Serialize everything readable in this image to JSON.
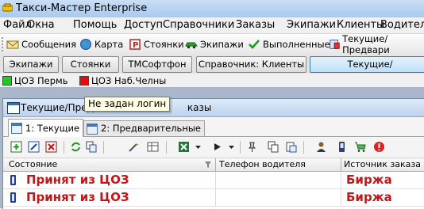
{
  "window": {
    "title": "Такси-Мастер Enterprise"
  },
  "menu": [
    "Файл",
    "Окна",
    "Помощь",
    "Доступ",
    "Справочники",
    "Заказы",
    "Экипажи",
    "Клиенты",
    "Водители"
  ],
  "main_toolbar": [
    {
      "label": "Сообщения",
      "icon": "envelope-icon"
    },
    {
      "label": "Карта",
      "icon": "map-icon"
    },
    {
      "label": "Стоянки",
      "icon": "parking-icon"
    },
    {
      "label": "Экипажи",
      "icon": "car-icon"
    },
    {
      "label": "Выполненные",
      "icon": "checkmark-icon"
    },
    {
      "label": "Текущие/Предвари",
      "icon": "orders-icon"
    }
  ],
  "tab_buttons": [
    "Экипажи",
    "Стоянки",
    "ТМСофтфон",
    "Справочник: Клиенты",
    "Текущие/Предварительные"
  ],
  "indicators": [
    {
      "label": "ЦОЗ Пермь",
      "color": "#22c922"
    },
    {
      "label": "ЦОЗ Наб.Челны",
      "color": "#e01010"
    }
  ],
  "child_window": {
    "title_left": "Текущие/Пред",
    "title_right": "казы",
    "tooltip": "Не задан логин",
    "tabs": [
      "1: Текущие",
      "2: Предварительные"
    ]
  },
  "grid": {
    "columns": [
      "Состояние",
      "Телефон водителя",
      "Источник заказа"
    ],
    "rows": [
      {
        "status": "Принят из ЦОЗ",
        "phone": "",
        "source": "Биржа"
      },
      {
        "status": "Принят из ЦОЗ",
        "phone": "",
        "source": "Биржа"
      }
    ]
  }
}
